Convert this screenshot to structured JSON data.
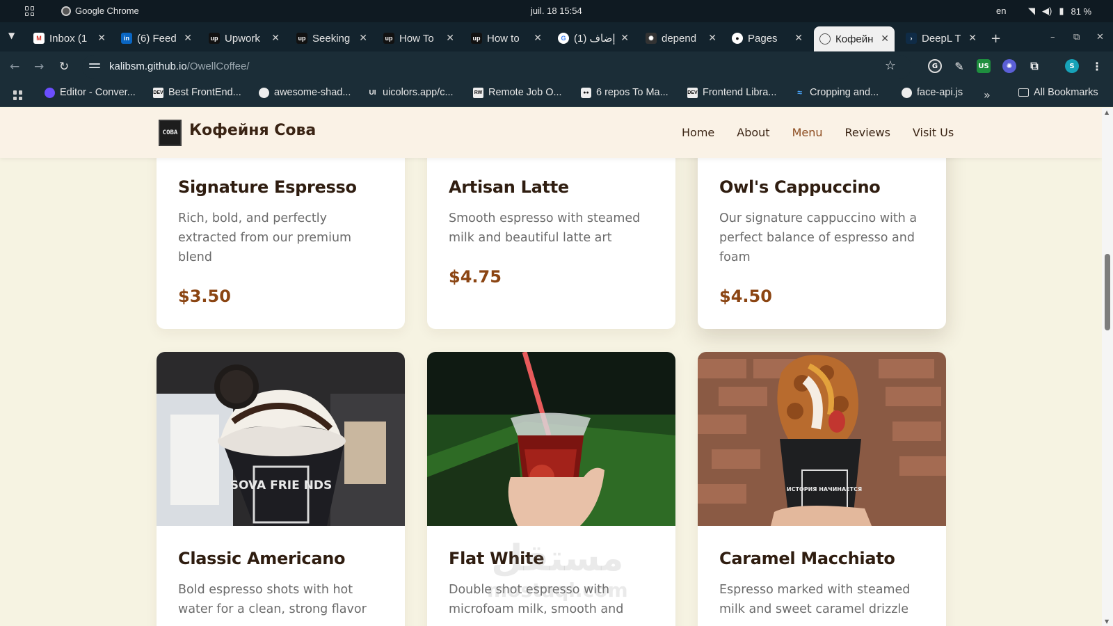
{
  "os": {
    "app_name": "Google Chrome",
    "clock": "juil. 18  15:54",
    "lang": "en",
    "battery": "81 %"
  },
  "tabs": [
    {
      "label": "Inbox (1",
      "icon": "gmail-icon"
    },
    {
      "label": "(6) Feed",
      "icon": "linkedin-icon"
    },
    {
      "label": "Upwork",
      "icon": "upwork-icon"
    },
    {
      "label": "Seeking",
      "icon": "upwork-icon"
    },
    {
      "label": "How To",
      "icon": "upwork-icon"
    },
    {
      "label": "How to",
      "icon": "upwork-icon"
    },
    {
      "label": "إضاف (1)",
      "icon": "google-icon"
    },
    {
      "label": "depend",
      "icon": "octopus-icon"
    },
    {
      "label": "Pages",
      "icon": "github-icon"
    },
    {
      "label": "Кофейн",
      "icon": "globe-icon"
    },
    {
      "label": "DeepL T",
      "icon": "deepl-icon"
    }
  ],
  "address": {
    "host": "kalibsm.github.io",
    "path": "/OwellCoffee/"
  },
  "bookmarks": [
    {
      "label": "Editor - Conver...",
      "icon": "purple-dot-icon"
    },
    {
      "label": "Best FrontEnd...",
      "icon": "dev-icon"
    },
    {
      "label": "awesome-shad...",
      "icon": "globe-icon"
    },
    {
      "label": "uicolors.app/c...",
      "icon": "ui-icon"
    },
    {
      "label": "Remote Job O...",
      "icon": "remote-icon"
    },
    {
      "label": "6 repos To Ma...",
      "icon": "medium-icon"
    },
    {
      "label": "Frontend Libra...",
      "icon": "dev-icon"
    },
    {
      "label": "Cropping and...",
      "icon": "wave-icon"
    },
    {
      "label": "face-api.js",
      "icon": "globe-icon"
    }
  ],
  "bookmarks_all": "All Bookmarks",
  "site": {
    "logo_text": "COBA",
    "brand": "Кофейня Сова",
    "nav": [
      "Home",
      "About",
      "Menu",
      "Reviews",
      "Visit Us"
    ],
    "active_nav": "Menu"
  },
  "menu_top": [
    {
      "name": "Signature Espresso",
      "desc": "Rich, bold, and perfectly extracted from our premium blend",
      "price": "$3.50"
    },
    {
      "name": "Artisan Latte",
      "desc": "Smooth espresso with steamed milk and beautiful latte art",
      "price": "$4.75"
    },
    {
      "name": "Owl's Cappuccino",
      "desc": "Our signature cappuccino with a perfect balance of espresso and foam",
      "price": "$4.50"
    }
  ],
  "menu_bottom": [
    {
      "name": "Classic Americano",
      "desc": "Bold espresso shots with hot water for a clean, strong flavor",
      "image": "iced-chocolate-drink-photo",
      "cup_text": "SOVA FRIE NDS"
    },
    {
      "name": "Flat White",
      "desc": "Double shot espresso with microfoam milk, smooth and",
      "image": "iced-red-tea-photo"
    },
    {
      "name": "Caramel Macchiato",
      "desc": "Espresso marked with steamed milk and sweet caramel drizzle",
      "image": "bubble-waffle-cup-photo",
      "cup_text": "ИСТОРИЯ НАЧИНАЕТСЯ"
    }
  ],
  "watermark": {
    "main": "مستقل",
    "sub": "mostaql.com"
  }
}
